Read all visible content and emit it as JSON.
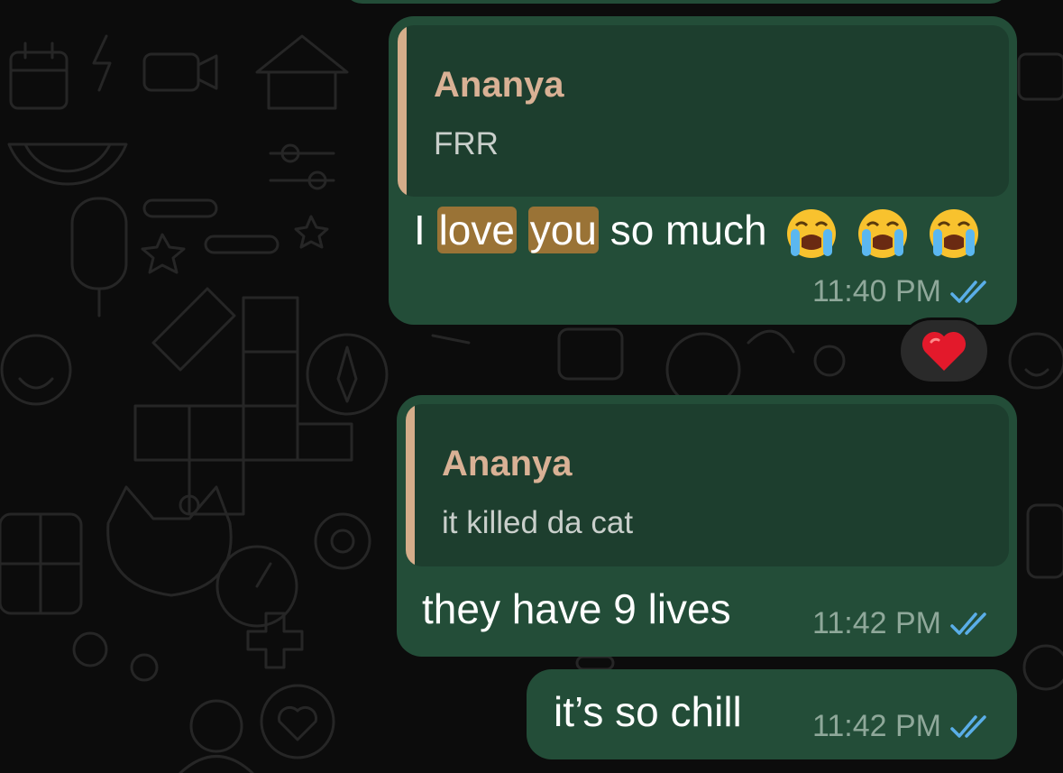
{
  "chat": {
    "messages": [
      {
        "quote_author": "Ananya",
        "quote_text": "FRR",
        "text_prefix": "I",
        "text_highlight_1": "love",
        "text_highlight_2": "you",
        "text_suffix": "so much",
        "emoji": "loudly-crying-face ×3",
        "time": "11:40 PM",
        "status": "read",
        "reaction": "red-heart"
      },
      {
        "quote_author": "Ananya",
        "quote_text": "it killed da cat",
        "text": "they have 9 lives",
        "time": "11:42 PM",
        "status": "read"
      },
      {
        "text": "it’s so chill",
        "time": "11:42 PM",
        "status": "read"
      }
    ]
  },
  "colors": {
    "bubble": "#234d38",
    "quote_bg": "#1d3e2e",
    "quote_bar": "#d5ad8a",
    "quote_author": "#d9b195",
    "highlight": "#9a7336",
    "read_ticks": "#5aaee8"
  }
}
